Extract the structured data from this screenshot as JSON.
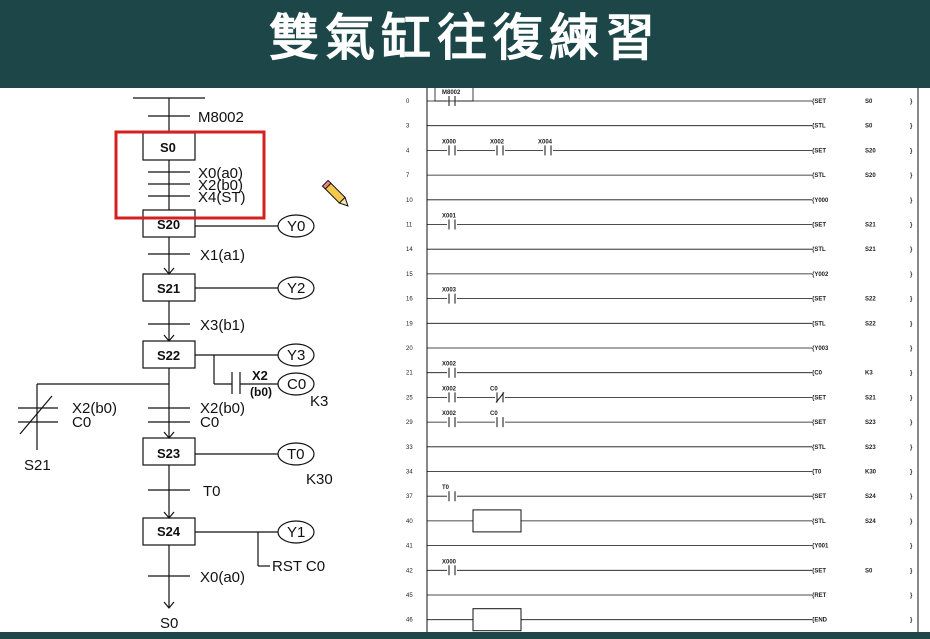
{
  "title": "雙氣缸往復練習",
  "sfc": {
    "start_contact": "M8002",
    "steps": [
      "S0",
      "S20",
      "S21",
      "S22",
      "S23",
      "S24"
    ],
    "s0_conditions": [
      "X0(a0)",
      "X2(b0)",
      "X4(ST)"
    ],
    "transitions": [
      "X1(a1)",
      "X3(b1)",
      "X2(b0)",
      "C0",
      "T0",
      "X0(a0)"
    ],
    "outputs": [
      "Y0",
      "Y2",
      "Y3",
      "C0",
      "T0",
      "Y1"
    ],
    "counter_contact": "X2",
    "counter_contact_sub": "(b0)",
    "counter_value": "K3",
    "timer_value": "K30",
    "branch_conditions": [
      "X2(b0)",
      "C0"
    ],
    "branch_target": "S21",
    "reset_label": "RST C0",
    "end_jump": "S0"
  },
  "ladder": {
    "rungs": [
      {
        "num": "0",
        "contacts": [
          "M8002"
        ],
        "instr": "SET",
        "arg": "S0"
      },
      {
        "num": "3",
        "contacts": [],
        "instr": "STL",
        "arg": "S0"
      },
      {
        "num": "4",
        "contacts": [
          "X000",
          "X002",
          "X004"
        ],
        "instr": "SET",
        "arg": "S20"
      },
      {
        "num": "7",
        "contacts": [],
        "instr": "STL",
        "arg": "S20"
      },
      {
        "num": "10",
        "contacts": [],
        "instr": "Y000",
        "arg": ""
      },
      {
        "num": "11",
        "contacts": [
          "X001"
        ],
        "instr": "SET",
        "arg": "S21"
      },
      {
        "num": "14",
        "contacts": [],
        "instr": "STL",
        "arg": "S21"
      },
      {
        "num": "15",
        "contacts": [],
        "instr": "Y002",
        "arg": ""
      },
      {
        "num": "16",
        "contacts": [
          "X003"
        ],
        "instr": "SET",
        "arg": "S22"
      },
      {
        "num": "19",
        "contacts": [],
        "instr": "STL",
        "arg": "S22"
      },
      {
        "num": "20",
        "contacts": [],
        "instr": "Y003",
        "arg": ""
      },
      {
        "num": "21",
        "contacts": [
          "X002"
        ],
        "instr": "C0",
        "arg": "K3"
      },
      {
        "num": "25",
        "contacts": [
          "X002",
          "C0"
        ],
        "instr": "SET",
        "arg": "S21"
      },
      {
        "num": "29",
        "contacts": [
          "X002",
          "C0"
        ],
        "instr": "SET",
        "arg": "S23"
      },
      {
        "num": "33",
        "contacts": [],
        "instr": "STL",
        "arg": "S23"
      },
      {
        "num": "34",
        "contacts": [],
        "instr": "T0",
        "arg": "K30"
      },
      {
        "num": "37",
        "contacts": [
          "T0"
        ],
        "instr": "SET",
        "arg": "S24"
      },
      {
        "num": "40",
        "contacts": [],
        "instr": "STL",
        "arg": "S24"
      },
      {
        "num": "41",
        "contacts": [],
        "instr": "Y001",
        "arg": ""
      },
      {
        "num": "42",
        "contacts": [
          "X000"
        ],
        "instr": "SET",
        "arg": "S0"
      },
      {
        "num": "45",
        "contacts": [],
        "instr": "RET",
        "arg": ""
      },
      {
        "num": "46",
        "contacts": [],
        "instr": "END",
        "arg": ""
      }
    ]
  },
  "colors": {
    "title_bg": "#1d4649",
    "highlight": "#d42020"
  }
}
